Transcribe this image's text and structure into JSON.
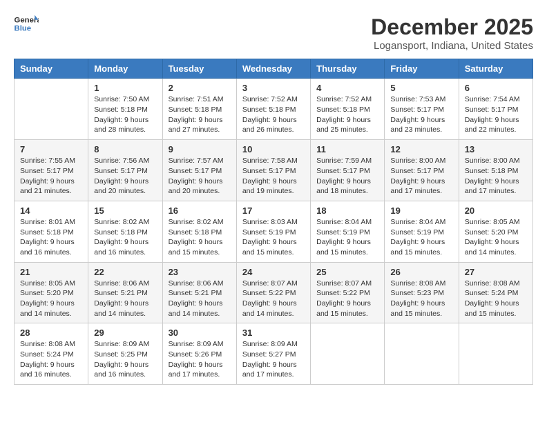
{
  "header": {
    "logo": {
      "line1": "General",
      "line2": "Blue"
    },
    "title": "December 2025",
    "subtitle": "Logansport, Indiana, United States"
  },
  "columns": [
    "Sunday",
    "Monday",
    "Tuesday",
    "Wednesday",
    "Thursday",
    "Friday",
    "Saturday"
  ],
  "weeks": [
    [
      {
        "day": "",
        "sunrise": "",
        "sunset": "",
        "daylight": ""
      },
      {
        "day": "1",
        "sunrise": "Sunrise: 7:50 AM",
        "sunset": "Sunset: 5:18 PM",
        "daylight": "Daylight: 9 hours and 28 minutes."
      },
      {
        "day": "2",
        "sunrise": "Sunrise: 7:51 AM",
        "sunset": "Sunset: 5:18 PM",
        "daylight": "Daylight: 9 hours and 27 minutes."
      },
      {
        "day": "3",
        "sunrise": "Sunrise: 7:52 AM",
        "sunset": "Sunset: 5:18 PM",
        "daylight": "Daylight: 9 hours and 26 minutes."
      },
      {
        "day": "4",
        "sunrise": "Sunrise: 7:52 AM",
        "sunset": "Sunset: 5:18 PM",
        "daylight": "Daylight: 9 hours and 25 minutes."
      },
      {
        "day": "5",
        "sunrise": "Sunrise: 7:53 AM",
        "sunset": "Sunset: 5:17 PM",
        "daylight": "Daylight: 9 hours and 23 minutes."
      },
      {
        "day": "6",
        "sunrise": "Sunrise: 7:54 AM",
        "sunset": "Sunset: 5:17 PM",
        "daylight": "Daylight: 9 hours and 22 minutes."
      }
    ],
    [
      {
        "day": "7",
        "sunrise": "Sunrise: 7:55 AM",
        "sunset": "Sunset: 5:17 PM",
        "daylight": "Daylight: 9 hours and 21 minutes."
      },
      {
        "day": "8",
        "sunrise": "Sunrise: 7:56 AM",
        "sunset": "Sunset: 5:17 PM",
        "daylight": "Daylight: 9 hours and 20 minutes."
      },
      {
        "day": "9",
        "sunrise": "Sunrise: 7:57 AM",
        "sunset": "Sunset: 5:17 PM",
        "daylight": "Daylight: 9 hours and 20 minutes."
      },
      {
        "day": "10",
        "sunrise": "Sunrise: 7:58 AM",
        "sunset": "Sunset: 5:17 PM",
        "daylight": "Daylight: 9 hours and 19 minutes."
      },
      {
        "day": "11",
        "sunrise": "Sunrise: 7:59 AM",
        "sunset": "Sunset: 5:17 PM",
        "daylight": "Daylight: 9 hours and 18 minutes."
      },
      {
        "day": "12",
        "sunrise": "Sunrise: 8:00 AM",
        "sunset": "Sunset: 5:17 PM",
        "daylight": "Daylight: 9 hours and 17 minutes."
      },
      {
        "day": "13",
        "sunrise": "Sunrise: 8:00 AM",
        "sunset": "Sunset: 5:18 PM",
        "daylight": "Daylight: 9 hours and 17 minutes."
      }
    ],
    [
      {
        "day": "14",
        "sunrise": "Sunrise: 8:01 AM",
        "sunset": "Sunset: 5:18 PM",
        "daylight": "Daylight: 9 hours and 16 minutes."
      },
      {
        "day": "15",
        "sunrise": "Sunrise: 8:02 AM",
        "sunset": "Sunset: 5:18 PM",
        "daylight": "Daylight: 9 hours and 16 minutes."
      },
      {
        "day": "16",
        "sunrise": "Sunrise: 8:02 AM",
        "sunset": "Sunset: 5:18 PM",
        "daylight": "Daylight: 9 hours and 15 minutes."
      },
      {
        "day": "17",
        "sunrise": "Sunrise: 8:03 AM",
        "sunset": "Sunset: 5:19 PM",
        "daylight": "Daylight: 9 hours and 15 minutes."
      },
      {
        "day": "18",
        "sunrise": "Sunrise: 8:04 AM",
        "sunset": "Sunset: 5:19 PM",
        "daylight": "Daylight: 9 hours and 15 minutes."
      },
      {
        "day": "19",
        "sunrise": "Sunrise: 8:04 AM",
        "sunset": "Sunset: 5:19 PM",
        "daylight": "Daylight: 9 hours and 15 minutes."
      },
      {
        "day": "20",
        "sunrise": "Sunrise: 8:05 AM",
        "sunset": "Sunset: 5:20 PM",
        "daylight": "Daylight: 9 hours and 14 minutes."
      }
    ],
    [
      {
        "day": "21",
        "sunrise": "Sunrise: 8:05 AM",
        "sunset": "Sunset: 5:20 PM",
        "daylight": "Daylight: 9 hours and 14 minutes."
      },
      {
        "day": "22",
        "sunrise": "Sunrise: 8:06 AM",
        "sunset": "Sunset: 5:21 PM",
        "daylight": "Daylight: 9 hours and 14 minutes."
      },
      {
        "day": "23",
        "sunrise": "Sunrise: 8:06 AM",
        "sunset": "Sunset: 5:21 PM",
        "daylight": "Daylight: 9 hours and 14 minutes."
      },
      {
        "day": "24",
        "sunrise": "Sunrise: 8:07 AM",
        "sunset": "Sunset: 5:22 PM",
        "daylight": "Daylight: 9 hours and 14 minutes."
      },
      {
        "day": "25",
        "sunrise": "Sunrise: 8:07 AM",
        "sunset": "Sunset: 5:22 PM",
        "daylight": "Daylight: 9 hours and 15 minutes."
      },
      {
        "day": "26",
        "sunrise": "Sunrise: 8:08 AM",
        "sunset": "Sunset: 5:23 PM",
        "daylight": "Daylight: 9 hours and 15 minutes."
      },
      {
        "day": "27",
        "sunrise": "Sunrise: 8:08 AM",
        "sunset": "Sunset: 5:24 PM",
        "daylight": "Daylight: 9 hours and 15 minutes."
      }
    ],
    [
      {
        "day": "28",
        "sunrise": "Sunrise: 8:08 AM",
        "sunset": "Sunset: 5:24 PM",
        "daylight": "Daylight: 9 hours and 16 minutes."
      },
      {
        "day": "29",
        "sunrise": "Sunrise: 8:09 AM",
        "sunset": "Sunset: 5:25 PM",
        "daylight": "Daylight: 9 hours and 16 minutes."
      },
      {
        "day": "30",
        "sunrise": "Sunrise: 8:09 AM",
        "sunset": "Sunset: 5:26 PM",
        "daylight": "Daylight: 9 hours and 17 minutes."
      },
      {
        "day": "31",
        "sunrise": "Sunrise: 8:09 AM",
        "sunset": "Sunset: 5:27 PM",
        "daylight": "Daylight: 9 hours and 17 minutes."
      },
      {
        "day": "",
        "sunrise": "",
        "sunset": "",
        "daylight": ""
      },
      {
        "day": "",
        "sunrise": "",
        "sunset": "",
        "daylight": ""
      },
      {
        "day": "",
        "sunrise": "",
        "sunset": "",
        "daylight": ""
      }
    ]
  ]
}
